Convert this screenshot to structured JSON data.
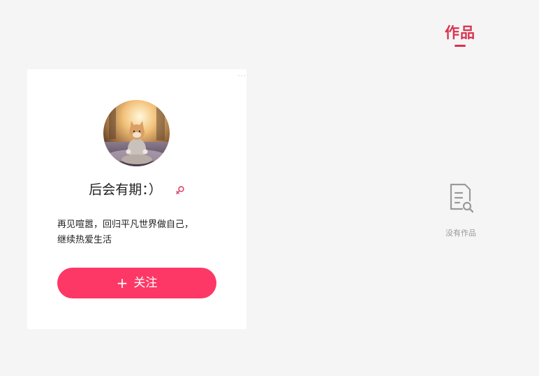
{
  "tabs": {
    "works_label": "作品"
  },
  "profile": {
    "more_label": "···",
    "name": "后会有期：）",
    "gender": "female",
    "bio_lines": [
      "再见喧嚣，回归平凡世界做自己，",
      "继续热爱生活"
    ],
    "follow_button": {
      "icon": "plus-icon",
      "plus": "+",
      "label": "关注"
    },
    "avatar_icon": "meditating-cat-avatar"
  },
  "empty_state": {
    "icon": "document-search-icon",
    "text": "没有作品"
  },
  "colors": {
    "accent": "#d8334f",
    "button": "#fd3866",
    "background": "#f5f5f5",
    "card": "#ffffff",
    "muted_text": "#999999"
  }
}
